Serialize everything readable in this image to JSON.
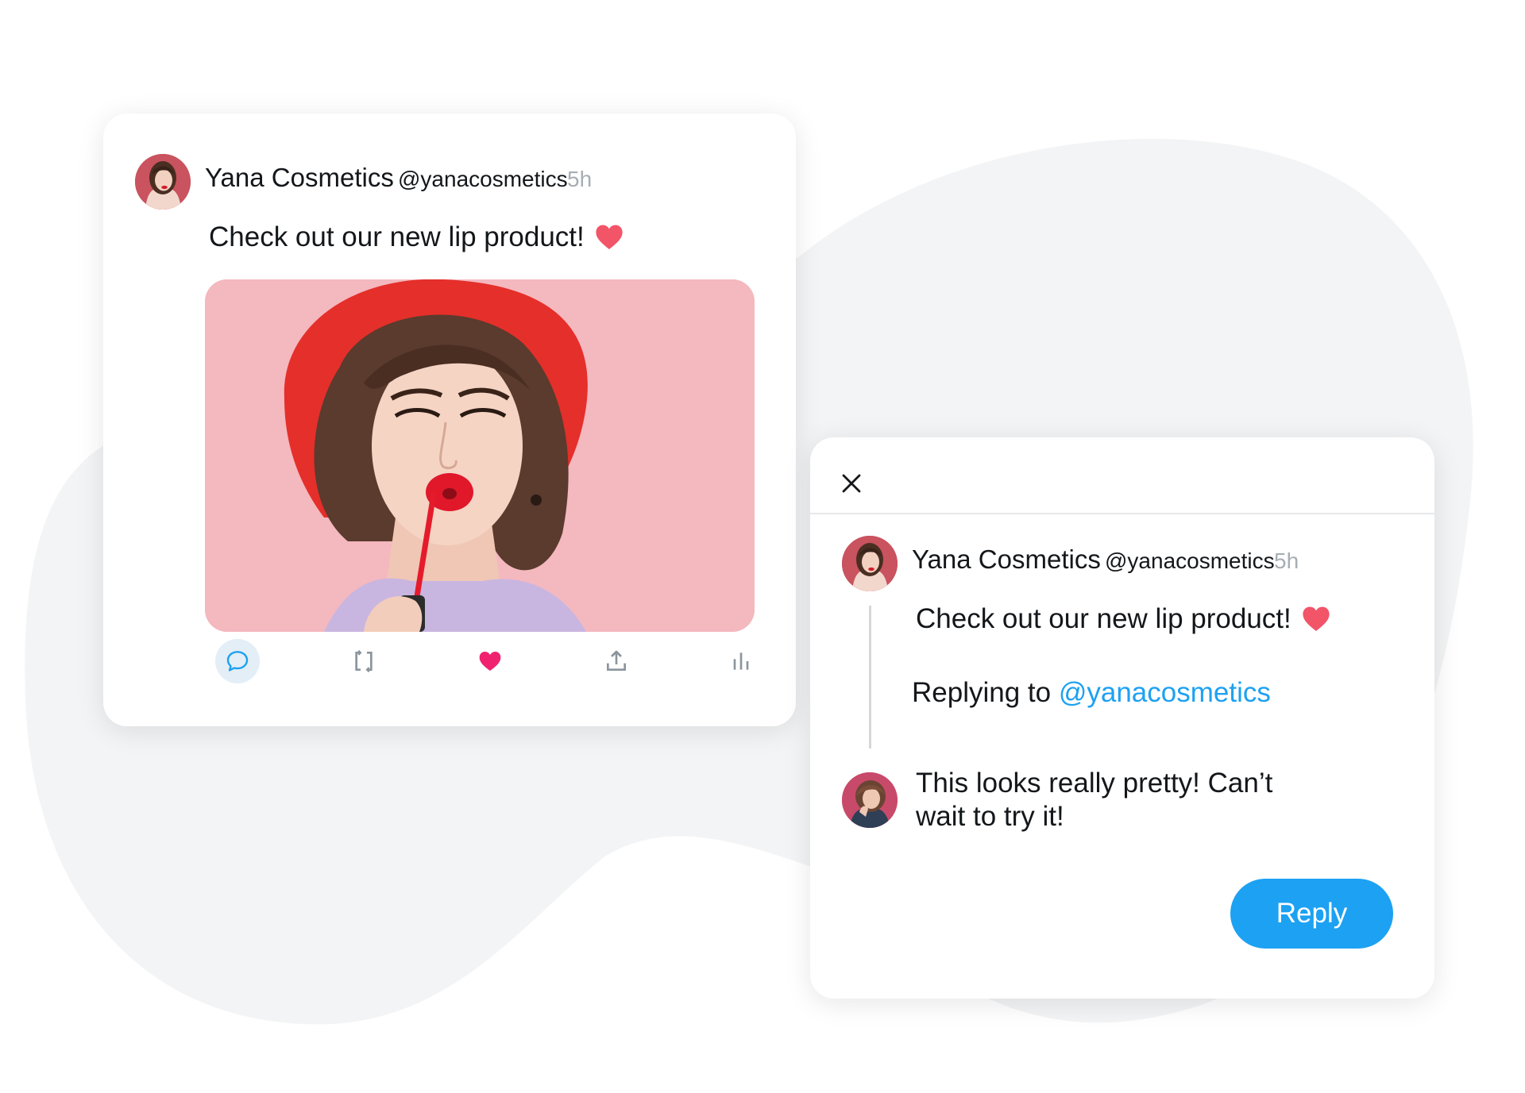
{
  "colors": {
    "accent_blue": "#1da1f2",
    "like_pink": "#f0226f",
    "heart_emoji": "#f25568",
    "blob_gray": "#f3f4f5",
    "muted_text": "#a7aeb4"
  },
  "tweet": {
    "account_name": "Yana Cosmetics",
    "handle": "@yanacosmetics",
    "time": "5h",
    "text": "Check out our new lip product!",
    "emoji": "red-heart-icon",
    "image": "woman-red-beret-lip-gloss-photo",
    "actions": [
      {
        "name": "reply-action",
        "icon": "speech-bubble-icon",
        "active": true
      },
      {
        "name": "retweet-action",
        "icon": "retweet-icon",
        "active": false
      },
      {
        "name": "like-action",
        "icon": "heart-icon",
        "active": true
      },
      {
        "name": "share-action",
        "icon": "share-icon",
        "active": false
      },
      {
        "name": "analytics-action",
        "icon": "bar-chart-icon",
        "active": false
      }
    ]
  },
  "reply_dialog": {
    "close_icon": "close-icon",
    "quoted": {
      "account_name": "Yana Cosmetics",
      "handle": "@yanacosmetics",
      "time": "5h",
      "text": "Check out our new lip product!"
    },
    "replying_to_label": "Replying to",
    "replying_to_handle": "@yanacosmetics",
    "draft_reply": "This looks really pretty! Can’t wait to try it!",
    "reply_button_label": "Reply"
  }
}
